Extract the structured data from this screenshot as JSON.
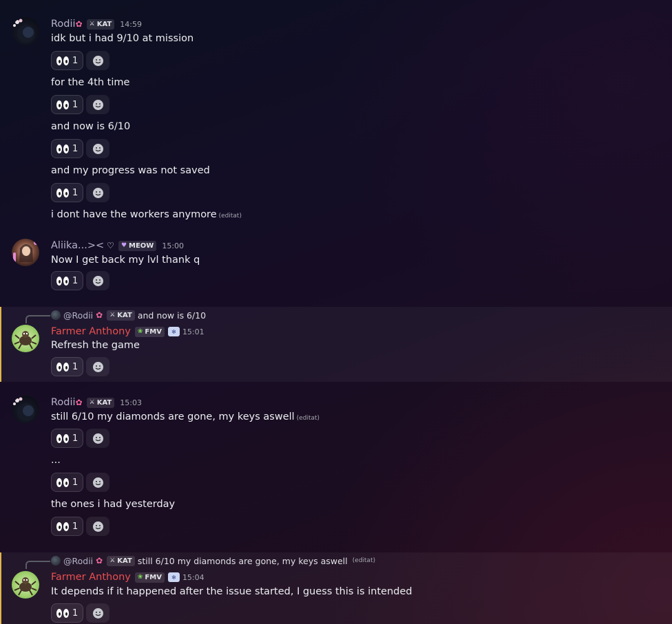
{
  "messages": [
    {
      "user": "Rodii",
      "tag": "KAT",
      "time": "14:59",
      "lines": [
        {
          "text": "idk but i had 9/10 at mission",
          "edited": "",
          "reaction_count": "1"
        },
        {
          "text": "for the 4th time",
          "edited": "",
          "reaction_count": "1"
        },
        {
          "text": "and now is 6/10",
          "edited": "",
          "reaction_count": "1"
        },
        {
          "text": "and my progress was not saved",
          "edited": "",
          "reaction_count": "1"
        },
        {
          "text": "i dont have the workers anymore",
          "edited": "(editat)",
          "reaction_count": ""
        }
      ]
    },
    {
      "user": "Aliika...><",
      "tag": "MEOW",
      "time": "15:00",
      "lines": [
        {
          "text": "Now I get back my lvl thank q",
          "edited": "",
          "reaction_count": "1"
        }
      ]
    },
    {
      "reply": {
        "mention": "@Rodii",
        "tag": "KAT",
        "text": "and now is 6/10",
        "edited": ""
      },
      "user": "Farmer Anthony",
      "tag": "FMV",
      "time": "15:01",
      "lines": [
        {
          "text": "Refresh the game",
          "edited": "",
          "reaction_count": "1"
        }
      ]
    },
    {
      "user": "Rodii",
      "tag": "KAT",
      "time": "15:03",
      "lines": [
        {
          "text": "still 6/10 my diamonds are gone, my keys aswell",
          "edited": "(editat)",
          "reaction_count": "1"
        },
        {
          "text": "...",
          "edited": "",
          "reaction_count": "1"
        },
        {
          "text": "the ones i had yesterday",
          "edited": "",
          "reaction_count": "1"
        }
      ]
    },
    {
      "reply": {
        "mention": "@Rodii",
        "tag": "KAT",
        "text": "still 6/10 my diamonds are gone, my keys aswell",
        "edited": "(editat)"
      },
      "user": "Farmer Anthony",
      "tag": "FMV",
      "time": "15:04",
      "lines": [
        {
          "text": "It depends if it happened after the issue started, I guess this is intended",
          "edited": "",
          "reaction_count": "1"
        }
      ]
    }
  ],
  "icons": {
    "reaction_emoji": "eyes-emoji",
    "add_reaction": "add-reaction-icon",
    "kat_tag_icon": "sword-icon",
    "meow_tag_icon": "heart-icon",
    "fmv_tag_icon": "leaf-icon"
  },
  "colors": {
    "username_default": "#b7b2cc",
    "username_farmer": "#e94f4f",
    "highlight_bar": "#e0b54a"
  }
}
